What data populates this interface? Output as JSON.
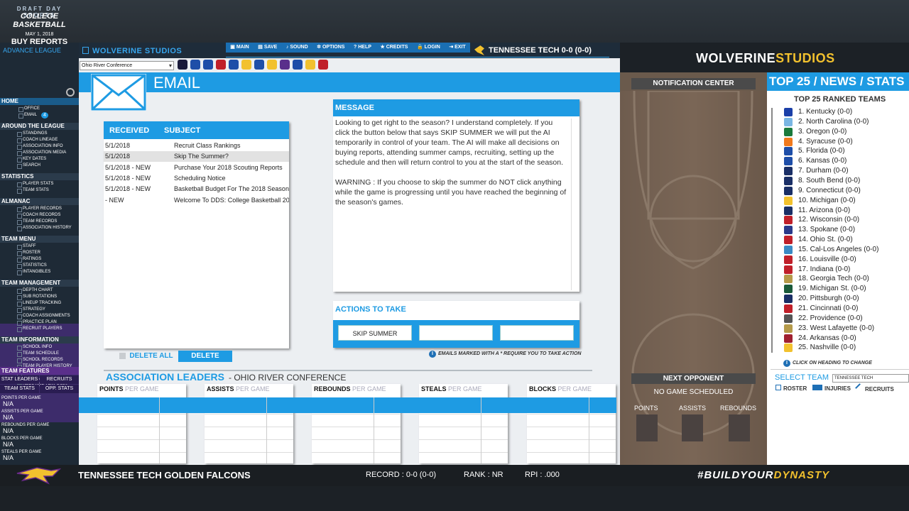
{
  "app": {
    "logo_top": "DRAFT DAY SPORTS",
    "logo_main": "COLLEGE BASKETBALL",
    "studio_name": "WOLVERINE STUDIOS",
    "top_team": "TENNESSEE TECH 0-0 (0-0)",
    "right_logo_a": "WOLVERINE",
    "right_logo_b": "STUDIOS"
  },
  "menu": [
    "MAIN",
    "SAVE",
    "SOUND",
    "OPTIONS",
    "HELP",
    "CREDITS",
    "LOGIN",
    "EXIT"
  ],
  "conference_select": "Ohio River Conference",
  "sidebar": {
    "date": "MAY 1, 2018",
    "buy_reports": "BUY REPORTS",
    "league_mode": "ADVANCE LEAGUE",
    "home": "HOME",
    "home_items": [
      "OFFICE",
      "EMAIL"
    ],
    "email_badge": "4",
    "around": "AROUND THE LEAGUE",
    "around_items": [
      "STANDINGS",
      "COACH LINEAGE",
      "ASSOCIATION INFO",
      "ASSOCIATION MEDIA",
      "KEY DATES",
      "SEARCH"
    ],
    "statistics": "STATISTICS",
    "statistics_items": [
      "PLAYER STATS",
      "TEAM STATS"
    ],
    "almanac": "ALMANAC",
    "almanac_items": [
      "PLAYER RECORDS",
      "COACH RECORDS",
      "TEAM RECORDS",
      "ASSOCIATION HISTORY"
    ],
    "team_menu": "TEAM MENU",
    "team_menu_items": [
      "STAFF",
      "ROSTER",
      "RATINGS",
      "STATISTICS",
      "INTANGIBLES"
    ],
    "team_management": "TEAM MANAGEMENT",
    "team_management_items": [
      "DEPTH CHART",
      "SUB ROTATIONS",
      "LINEUP TRACKING",
      "STRATEGY",
      "COACH ASSIGNMENTS",
      "PRACTICE PLAN",
      "RECRUIT PLAYERS"
    ],
    "team_information": "TEAM INFORMATION",
    "team_information_items": [
      "SCHOOL INFO",
      "TEAM SCHEDULE",
      "SCHOOL RECORDS",
      "TEAM PLAYER HISTORY",
      "TEAM HISTORY",
      "SEASON RECAPS",
      "PRESTIGE TRACKING"
    ]
  },
  "team_features": {
    "title": "TEAM FEATURES",
    "tabs": [
      "STAT LEADERS",
      "RECRUITS",
      "TEAM STATS",
      "OPP. STATS"
    ],
    "stats": [
      {
        "label": "POINTS PER GAME",
        "value": "N/A"
      },
      {
        "label": "ASSISTS PER GAME",
        "value": "N/A"
      },
      {
        "label": "REBOUNDS PER GAME",
        "value": "N/A"
      },
      {
        "label": "BLOCKS PER GAME",
        "value": "N/A"
      },
      {
        "label": "STEALS PER GAME",
        "value": "N/A"
      }
    ]
  },
  "email": {
    "title": "EMAIL",
    "col_received": "RECEIVED",
    "col_subject": "SUBJECT",
    "rows": [
      {
        "date": "5/1/2018",
        "subject": "Recruit Class Rankings"
      },
      {
        "date": "5/1/2018",
        "subject": "Skip The Summer?"
      },
      {
        "date": "5/1/2018 - NEW",
        "subject": "Purchase Your 2018 Scouting Reports"
      },
      {
        "date": "5/1/2018 - NEW",
        "subject": "Scheduling Notice"
      },
      {
        "date": "5/1/2018 - NEW",
        "subject": "Basketball Budget For The 2018 Season"
      },
      {
        "date": " - NEW",
        "subject": "Welcome To DDS: College Basketball 2019"
      }
    ],
    "delete_all": "DELETE ALL",
    "delete": "DELETE"
  },
  "message": {
    "title": "MESSAGE",
    "body": "Looking to get right to the season? I understand completely. If you click the button below that says SKIP SUMMER we will put the AI temporarily in control of your team. The AI will make all decisions on buying reports, attending summer camps, recruiting, setting up the schedule and then will return control to you at the start of the season.\n\nWARNING : If you choose to skip the summer do NOT click anything while the game is progressing until you have reached the beginning of the season's games.",
    "actions_title": "ACTIONS TO TAKE",
    "action_buttons": [
      "SKIP SUMMER",
      "",
      ""
    ],
    "note": "EMAILS MARKED WITH A * REQUIRE YOU TO TAKE ACTION"
  },
  "leaders": {
    "title": "ASSOCIATION LEADERS",
    "subtitle": "- OHIO RIVER CONFERENCE",
    "tables": [
      {
        "a": "POINTS",
        "b": "PER GAME"
      },
      {
        "a": "ASSISTS",
        "b": "PER GAME"
      },
      {
        "a": "REBOUNDS",
        "b": "PER GAME"
      },
      {
        "a": "STEALS",
        "b": "PER GAME"
      },
      {
        "a": "BLOCKS",
        "b": "PER GAME"
      }
    ]
  },
  "notification": {
    "title": "NOTIFICATION CENTER",
    "next_opponent": "NEXT OPPONENT",
    "no_game": "NO GAME SCHEDULED",
    "stats": [
      "POINTS",
      "ASSISTS",
      "REBOUNDS"
    ]
  },
  "top25": {
    "header": "TOP 25 / NEWS / STATS",
    "subtitle": "TOP 25 RANKED TEAMS",
    "teams": [
      "1. Kentucky  (0-0)",
      "2. North Carolina  (0-0)",
      "3. Oregon  (0-0)",
      "4. Syracuse  (0-0)",
      "5. Florida  (0-0)",
      "6. Kansas  (0-0)",
      "7. Durham  (0-0)",
      "8. South Bend  (0-0)",
      "9. Connecticut  (0-0)",
      "10. Michigan  (0-0)",
      "11. Arizona  (0-0)",
      "12. Wisconsin  (0-0)",
      "13. Spokane  (0-0)",
      "14. Ohio St.  (0-0)",
      "15. Cal-Los Angeles  (0-0)",
      "16. Louisville  (0-0)",
      "17. Indiana  (0-0)",
      "18. Georgia Tech  (0-0)",
      "19. Michigan St.  (0-0)",
      "20. Pittsburgh  (0-0)",
      "21. Cincinnati  (0-0)",
      "22. Providence  (0-0)",
      "23. West Lafayette  (0-0)",
      "24. Arkansas  (0-0)",
      "25. Nashville  (0-0)"
    ],
    "team_colors": [
      "#1b3fa8",
      "#7ab6e3",
      "#1a7a3c",
      "#f07a1e",
      "#1e4ea8",
      "#1e4ea8",
      "#1a2f66",
      "#1a2f66",
      "#1a2f66",
      "#f2c12e",
      "#1a2f66",
      "#c0202a",
      "#2a3a8a",
      "#c0202a",
      "#3a8ac4",
      "#c0202a",
      "#c0202a",
      "#b59a4a",
      "#1a5a3a",
      "#1a2f66",
      "#c0202a",
      "#555555",
      "#b59a4a",
      "#a02030",
      "#f2c12e"
    ],
    "note": "CLICK ON HEADING TO CHANGE",
    "select_label": "SELECT TEAM",
    "select_value": "TENNESSEE TECH",
    "links": [
      "ROSTER",
      "INJURIES",
      "RECRUITS"
    ]
  },
  "bottom": {
    "team_name": "TENNESSEE TECH GOLDEN FALCONS",
    "record": "RECORD :  0-0 (0-0)",
    "rank": "RANK :  NR",
    "rpi": "RPI :  .000",
    "tag_a": "#BUILDYOUR",
    "tag_b": "DYNASTY"
  },
  "colors": {
    "accent": "#1e9be3",
    "gold": "#f2c12e",
    "purple": "#3d2c6b"
  }
}
